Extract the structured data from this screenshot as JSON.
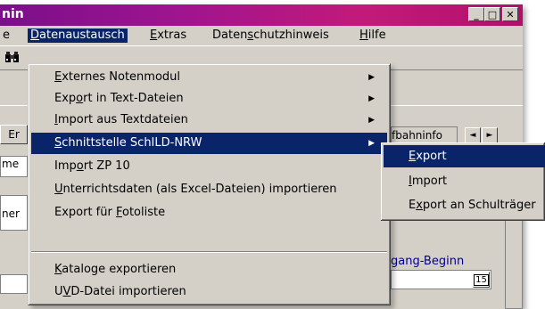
{
  "window": {
    "title": "nin",
    "controls": {
      "minimize": "_",
      "maximize": "□",
      "close": "✕"
    }
  },
  "menubar": {
    "items": [
      {
        "label": "e",
        "underline": "",
        "rest": ""
      },
      {
        "label": "Datenaustausch",
        "underline": "D",
        "rest": "atenaustausch"
      },
      {
        "label": "Extras",
        "underline": "E",
        "rest": "xtras"
      },
      {
        "pre": "Daten",
        "underline": "s",
        "rest": "chutzhinweis",
        "label": "Datenschutzhinweis"
      },
      {
        "label": "Hilfe",
        "underline": "H",
        "rest": "ilfe"
      }
    ]
  },
  "background": {
    "tab_left": "Er",
    "field_label_1": "me",
    "field_label_2": "ner",
    "tab_right_label": "fbahninfo",
    "nav_prev": "◄",
    "nav_next": "►",
    "blue_label": "gang-Beginn",
    "calendar_day": "15"
  },
  "dropdown": {
    "items": [
      {
        "pre": "",
        "u": "E",
        "post": "xternes Notenmodul",
        "submenu": true
      },
      {
        "pre": "Exp",
        "u": "o",
        "post": "rt in Text-Dateien",
        "submenu": true
      },
      {
        "pre": "",
        "u": "I",
        "post": "mport aus Textdateien",
        "submenu": true
      },
      {
        "pre": "",
        "u": "S",
        "post": "chnittstelle SchILD-NRW",
        "submenu": true,
        "highlight": true
      },
      {
        "pre": "Imp",
        "u": "o",
        "post": "rt ZP 10",
        "submenu": false
      },
      {
        "pre": "",
        "u": "U",
        "post": "nterrichtsdaten (als Excel-Dateien) importieren",
        "submenu": false
      },
      {
        "pre": "Export für ",
        "u": "F",
        "post": "otoliste",
        "submenu": false
      },
      {
        "pre": "",
        "u": "K",
        "post": "ataloge exportieren",
        "submenu": false
      },
      {
        "pre": "U",
        "u": "V",
        "post": "D-Datei importieren",
        "submenu": false
      }
    ],
    "submenu_arrow": "▶"
  },
  "submenu": {
    "items": [
      {
        "pre": "",
        "u": "E",
        "post": "xport",
        "highlight": true
      },
      {
        "pre": "",
        "u": "I",
        "post": "mport",
        "highlight": false
      },
      {
        "pre": "E",
        "u": "x",
        "post": "port an Schulträger",
        "highlight": false
      }
    ]
  },
  "colors": {
    "highlight": "#0a246a",
    "face": "#d4d0c8",
    "link_blue": "#00008b"
  }
}
